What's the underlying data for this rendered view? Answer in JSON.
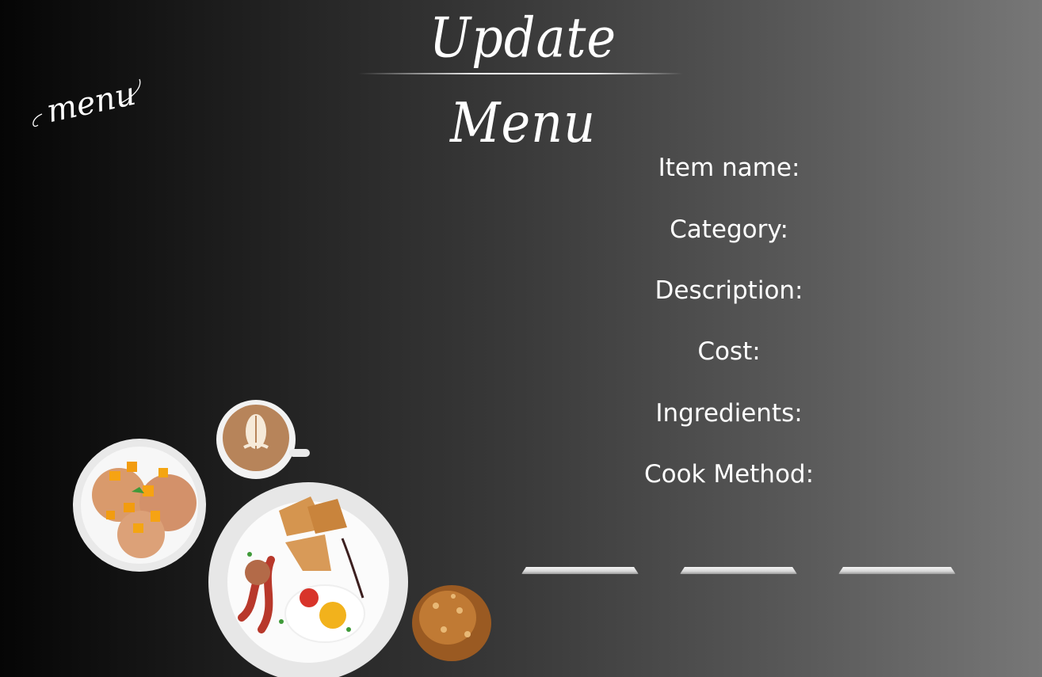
{
  "header": {
    "title": "Update Menu"
  },
  "brand": {
    "text": "menu"
  },
  "form": {
    "labels": {
      "item_name": "Item name:",
      "category": "Category:",
      "description": "Description:",
      "cost": "Cost:",
      "ingredients": "Ingredients:",
      "cook_method": "Cook Method:"
    }
  },
  "icons": {
    "food": "breakfast-plates-illustration",
    "coffee": "latte-cup-icon",
    "pancakes": "mango-pancakes-plate",
    "granola": "granola-pile"
  }
}
